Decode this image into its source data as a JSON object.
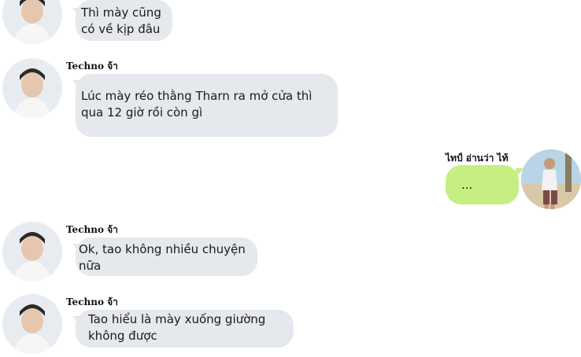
{
  "messages": [
    {
      "sender": "",
      "text_lines": [
        "Thì mày cũng",
        "có về kịp đâu"
      ]
    },
    {
      "sender": "Techno จ้า",
      "text_lines": [
        "Lúc mày réo thằng Tharn ra mở cửa thì",
        "qua 12 giờ rồi còn gì"
      ]
    },
    {
      "sender": "ไทป์ อ่านว่า ไท้",
      "text_lines": [
        "..."
      ]
    },
    {
      "sender": "Techno จ้า",
      "text_lines": [
        "Ok, tao không nhiều chuyện",
        "nữa"
      ]
    },
    {
      "sender": "Techno จ้า",
      "text_lines": [
        "Tao hiểu là mày xuống giường",
        "không được"
      ]
    }
  ],
  "avatars": {
    "incoming": "avatar-techno",
    "outgoing": "avatar-type"
  },
  "colors": {
    "incoming_bubble": "#e5e8ec",
    "outgoing_bubble": "#c6ee83",
    "background": "#ffffff"
  }
}
